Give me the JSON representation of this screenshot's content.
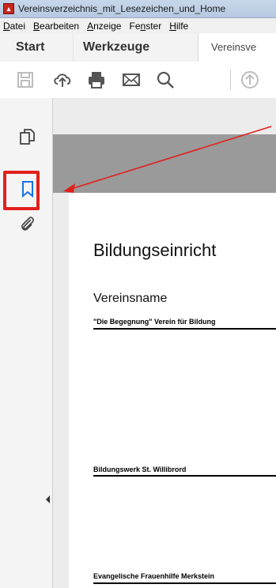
{
  "window": {
    "title": "Vereinsverzeichnis_mit_Lesezeichen_und_Home"
  },
  "menu": [
    {
      "prefix": "",
      "accel": "D",
      "rest": "atei"
    },
    {
      "prefix": "",
      "accel": "B",
      "rest": "earbeiten"
    },
    {
      "prefix": "",
      "accel": "A",
      "rest": "nzeige"
    },
    {
      "prefix": "Fe",
      "accel": "n",
      "rest": "ster"
    },
    {
      "prefix": "",
      "accel": "H",
      "rest": "ilfe"
    }
  ],
  "tabs": {
    "start": "Start",
    "werkzeuge": "Werkzeuge",
    "document": "Vereinsve"
  },
  "document": {
    "heading": "Bildungseinricht",
    "column_header": "Vereinsname",
    "rows": [
      "\"Die Begegnung\" Verein für Bildung",
      "Bildungswerk St. Willibrord",
      "Evangelische Frauenhilfe Merkstein"
    ]
  },
  "colors": {
    "highlight": "#e2201c",
    "bookmark_icon": "#1473e6",
    "acrobat_red": "#c8241c"
  },
  "icons": [
    "acrobat-icon",
    "save-icon",
    "upload-icon",
    "print-icon",
    "email-icon",
    "search-icon",
    "previous-page-icon",
    "page-thumbnails-icon",
    "bookmarks-icon",
    "attachments-icon",
    "collapse-panel-icon"
  ]
}
